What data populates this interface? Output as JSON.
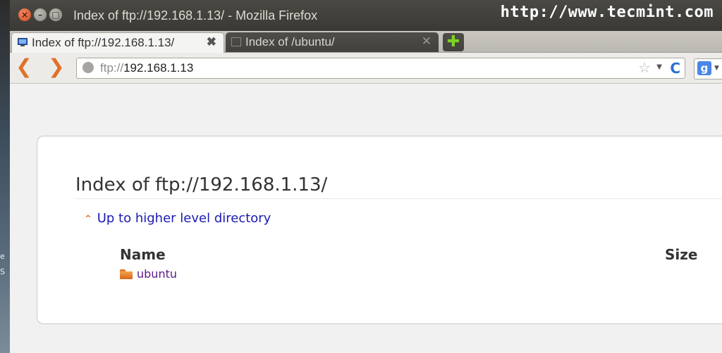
{
  "window": {
    "title": "Index of ftp://192.168.1.13/ - Mozilla Firefox",
    "controls": {
      "close": "×",
      "minimize": "–",
      "maximize": "□"
    }
  },
  "watermark": "http://www.tecmint.com",
  "desktop_fragments": [
    "e",
    "S"
  ],
  "tabs": [
    {
      "label": "Index of ftp://192.168.1.13/",
      "active": true,
      "close": "✖"
    },
    {
      "label": "Index of /ubuntu/",
      "active": false,
      "close": "✕"
    }
  ],
  "new_tab": "✚",
  "nav": {
    "back": "❮",
    "forward": "❯",
    "url_scheme": "ftp://",
    "url_host": "192.168.1.13",
    "bookmark_star": "☆",
    "dropdown": "▼",
    "reload": "C",
    "search_engine": "g",
    "search_dropdown": "▼"
  },
  "listing": {
    "title": "Index of ftp://192.168.1.13/",
    "up_icon": "⌃",
    "up_link": "Up to higher level directory",
    "columns": {
      "name": "Name",
      "size": "Size"
    },
    "rows": [
      {
        "name": "ubuntu",
        "type": "folder",
        "size": ""
      }
    ]
  },
  "colors": {
    "accent_orange": "#e0702a",
    "link_blue": "#1a1ab5",
    "visited_purple": "#5a1a8c",
    "title_bar": "#3a3935"
  }
}
